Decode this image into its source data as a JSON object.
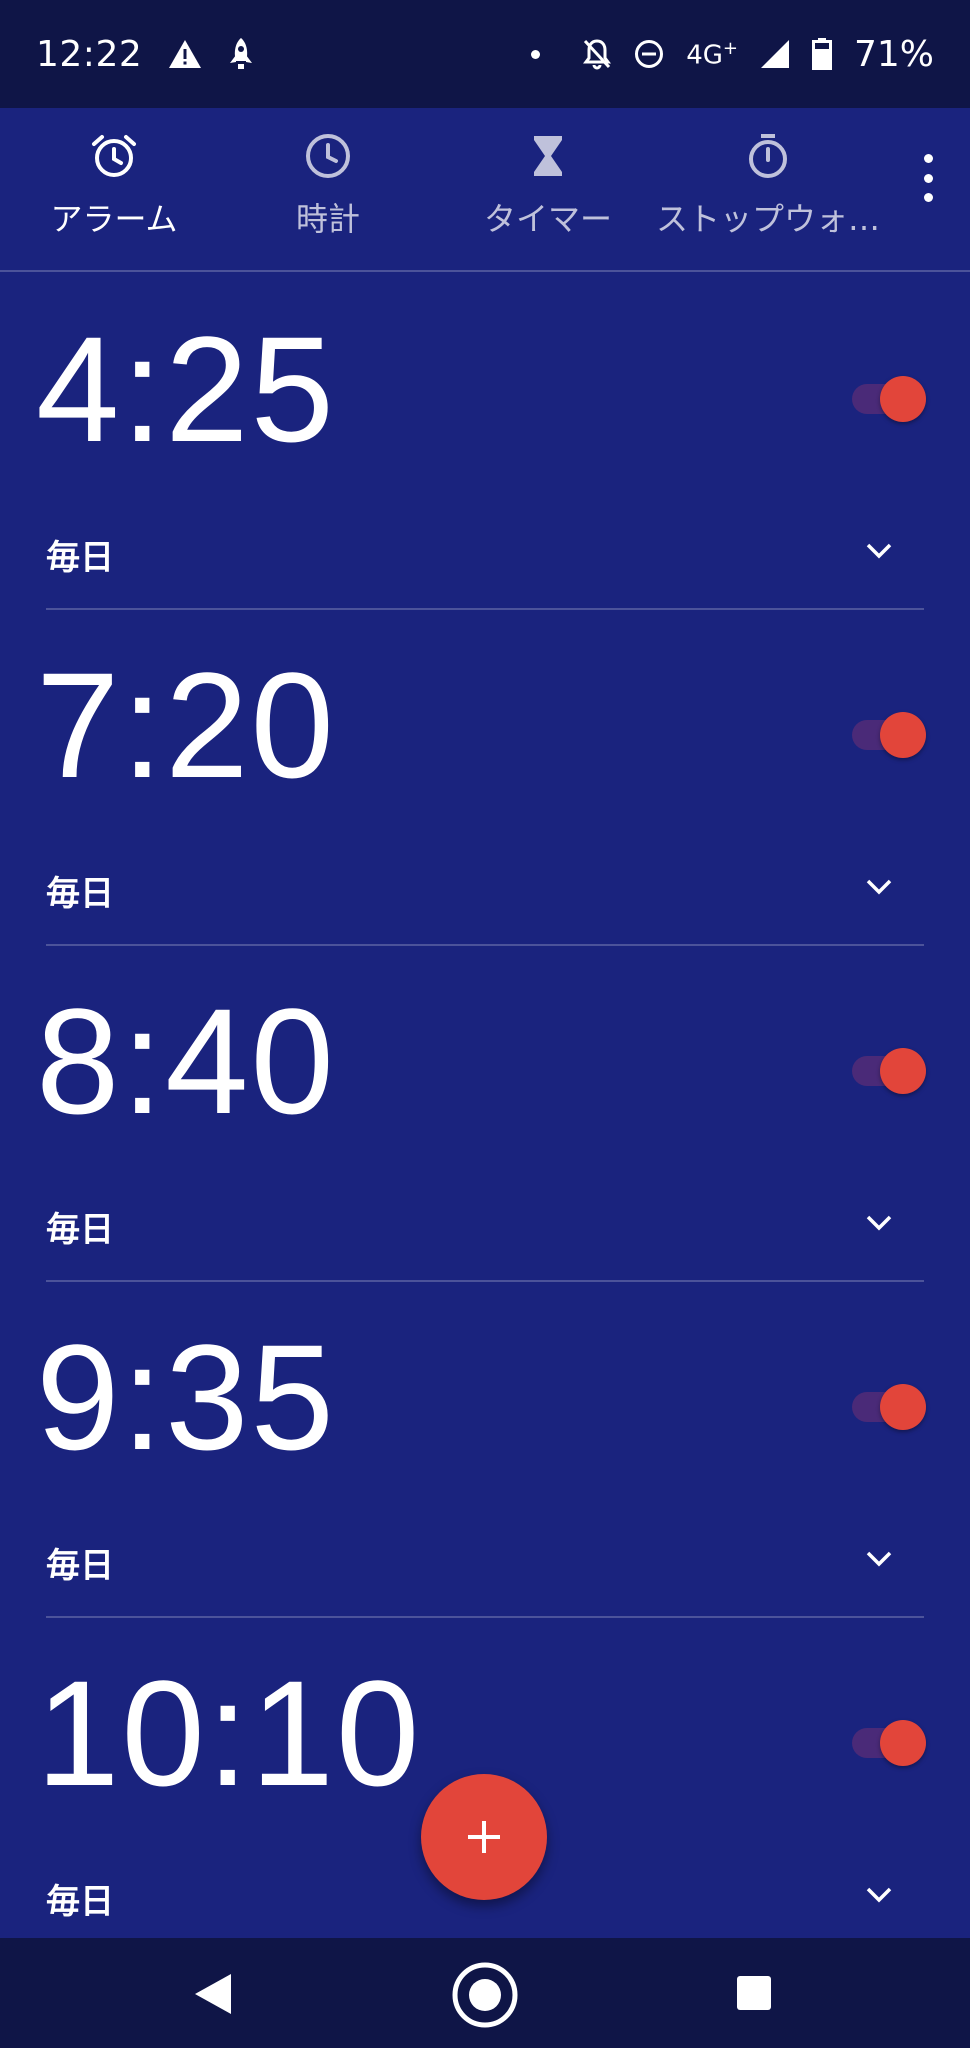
{
  "status_bar": {
    "time": "12:22",
    "network": "4G",
    "network_plus": "+",
    "battery": "71%",
    "icons": [
      "warning-icon",
      "rocket-icon",
      "notification-dot",
      "bell-off-icon",
      "do-not-disturb-icon",
      "signal-icon",
      "battery-icon"
    ]
  },
  "tabs": [
    {
      "label": "アラーム",
      "icon": "alarm-clock-icon",
      "active": true
    },
    {
      "label": "時計",
      "icon": "clock-icon",
      "active": false
    },
    {
      "label": "タイマー",
      "icon": "hourglass-icon",
      "active": false
    },
    {
      "label": "ストップウォ…",
      "icon": "stopwatch-icon",
      "active": false
    }
  ],
  "alarms": [
    {
      "time": "4:25",
      "repeat": "毎日",
      "enabled": true
    },
    {
      "time": "7:20",
      "repeat": "毎日",
      "enabled": true
    },
    {
      "time": "8:40",
      "repeat": "毎日",
      "enabled": true
    },
    {
      "time": "9:35",
      "repeat": "毎日",
      "enabled": true
    },
    {
      "time": "10:10",
      "repeat": "毎日",
      "enabled": true
    }
  ],
  "fab": {
    "icon": "plus-icon"
  },
  "colors": {
    "background": "#1a237e",
    "status_bar": "#0f1547",
    "accent": "#e2453a",
    "toggle_track": "#4a2a78"
  },
  "nav_bar": {
    "icons": [
      "back-icon",
      "home-icon",
      "recents-icon"
    ]
  }
}
